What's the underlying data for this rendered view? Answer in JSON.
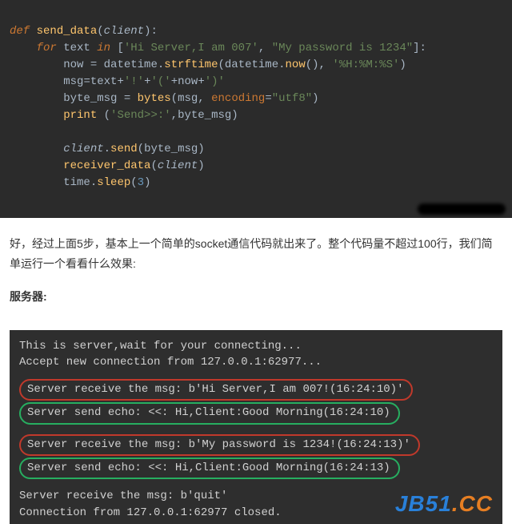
{
  "code": {
    "l1": {
      "def": "def ",
      "fn": "send_data",
      "open": "(",
      "param": "client",
      "close": ")",
      ":": ":"
    },
    "l2": {
      "indent": "    ",
      "for": "for ",
      "var": "text ",
      "in": "in ",
      "open": "[",
      "s1": "'Hi Server,I am 007'",
      "comma": ", ",
      "s2": "\"My password is 1234\"",
      "close": "]:"
    },
    "l3": {
      "indent": "        ",
      "lhs": "now ",
      "eq": "= ",
      "obj": "datetime.",
      "fn": "strftime",
      "open": "(",
      "arg1": "datetime.",
      "fn2": "now",
      "paren": "()",
      "comma": ", ",
      "s": "'%H:%M:%S'",
      "close": ")"
    },
    "l4": {
      "indent": "        ",
      "lhs": "msg",
      "eq": "=",
      "rhs1": "text",
      "plus1": "+",
      "s1": "'!'",
      "plus2": "+",
      "s2": "'('",
      "plus3": "+",
      "rhs2": "now",
      "plus4": "+",
      "s3": "')'"
    },
    "l5": {
      "indent": "        ",
      "lhs": "byte_msg ",
      "eq": "= ",
      "fn": "bytes",
      "open": "(",
      "arg1": "msg",
      "comma": ", ",
      "kw": "encoding",
      "eq2": "=",
      "s": "\"utf8\"",
      "close": ")"
    },
    "l6": {
      "indent": "        ",
      "fn": "print ",
      "open": "(",
      "s": "'Send>>:'",
      "comma": ",",
      "arg": "byte_msg",
      "close": ")"
    },
    "l7": {
      "indent": "        ",
      "obj": "client",
      "dot": ".",
      "fn": "send",
      "open": "(",
      "arg": "byte_msg",
      "close": ")"
    },
    "l8": {
      "indent": "        ",
      "fn": "receiver_data",
      "open": "(",
      "arg": "client",
      "close": ")"
    },
    "l9": {
      "indent": "        ",
      "obj": "time.",
      "fn": "sleep",
      "open": "(",
      "num": "3",
      "close": ")"
    }
  },
  "article": {
    "p1": "好，经过上面5步，基本上一个简单的socket通信代码就出来了。整个代码量不超过100行，我们简单运行一个看看什么效果:",
    "h1": "服务器:"
  },
  "terminal": {
    "t1": "This is server,wait for your connecting...",
    "t2": "Accept new connection from 127.0.0.1:62977...",
    "t3": "Server receive the msg: b'Hi Server,I am 007!(16:24:10)'",
    "t4": "Server send echo: <<: Hi,Client:Good Morning(16:24:10)",
    "t5": "Server receive the msg: b'My password is 1234!(16:24:13)'",
    "t6": "Server send echo: <<: Hi,Client:Good Morning(16:24:13)",
    "t7": "Server receive the msg: b'quit'",
    "t8": "Connection from 127.0.0.1:62977 closed."
  },
  "watermark": {
    "a": "JB51",
    "b": ".CC"
  }
}
